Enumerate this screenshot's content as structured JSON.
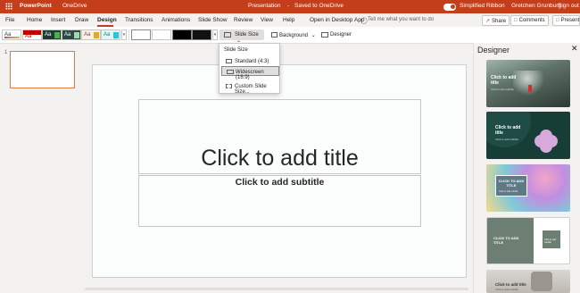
{
  "titlebar": {
    "app": "PowerPoint",
    "location": "OneDrive",
    "doc_title": "Presentation",
    "sep": "-",
    "save_status": "Saved to OneDrive",
    "simplified_ribbon": "Simplified Ribbon",
    "user": "Gretchen Grunburg",
    "signout": "Sign out"
  },
  "tabs": [
    "File",
    "Home",
    "Insert",
    "Draw",
    "Design",
    "Transitions",
    "Animations",
    "Slide Show",
    "Review",
    "View",
    "Help"
  ],
  "open_desktop": "Open in Desktop App",
  "tell_me": "Tell me what you want to do",
  "share": "Share",
  "comments": "Comments",
  "present": "Present",
  "theme_labels": [
    "Aa",
    "Aa",
    "Aa",
    "Aa",
    "Aa",
    "Aa"
  ],
  "slide_size_btn": "Slide Size",
  "background_btn": "Background",
  "designer_btn": "Designer",
  "dropdown": {
    "header": "Slide Size",
    "items": [
      "Standard (4:3)",
      "Widescreen (16:9)",
      "Custom Slide Size..."
    ],
    "selected": "Widescreen (16:9)"
  },
  "thumb_number": "1",
  "slide": {
    "title_placeholder": "Click to add title",
    "subtitle_placeholder": "Click to add subtitle"
  },
  "designer_pane": {
    "title": "Designer",
    "cards": [
      {
        "title": "Click to add title",
        "sub": "Click to add subtitle"
      },
      {
        "title": "Click to add title",
        "sub": "Click to add subtitle"
      },
      {
        "title": "CLICK TO ADD TITLE",
        "sub": "Click to add subtitle"
      },
      {
        "title": "CLICK TO ADD TITLE",
        "sub": "Click to add subtitle"
      },
      {
        "title": "Click to add title",
        "sub": "Click to add subtitle"
      }
    ]
  },
  "colors": {
    "brand": "#c43e1c",
    "selection": "#e8763f"
  }
}
